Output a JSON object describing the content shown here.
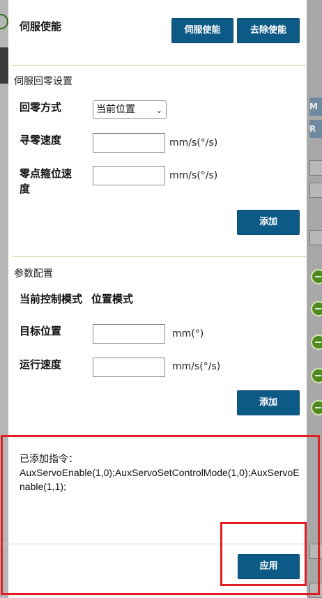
{
  "servo": {
    "title": "伺服使能",
    "enable_button": "伺服使能",
    "disable_button": "去除使能"
  },
  "homing": {
    "title": "伺服回零设置",
    "mode_label": "回零方式",
    "mode_value": "当前位置",
    "search_speed_label": "寻零速度",
    "search_speed_value": "",
    "search_speed_unit": "mm/s(°/s)",
    "latch_speed_label_line1": "零点箍位速",
    "latch_speed_label_line2": "度",
    "latch_speed_value": "",
    "latch_speed_unit": "mm/s(°/s)",
    "add_button": "添加"
  },
  "params": {
    "title": "参数配置",
    "mode_label": "当前控制模式",
    "mode_value": "位置模式",
    "target_label": "目标位置",
    "target_value": "",
    "target_unit": "mm(°)",
    "speed_label": "运行速度",
    "speed_value": "",
    "speed_unit": "mm/s(°/s)",
    "add_button": "添加"
  },
  "commands": {
    "title": "已添加指令：",
    "text": "AuxServoEnable(1,0);AuxServoSetControlMode(1,0);AuxServoEnable(1,1);",
    "apply_button": "应用"
  },
  "background": {
    "right_bar_letters": [
      "M",
      "R"
    ]
  },
  "colors": {
    "button": "#0d5a86",
    "separator": "#b9c98a",
    "highlight": "#e21d25"
  }
}
